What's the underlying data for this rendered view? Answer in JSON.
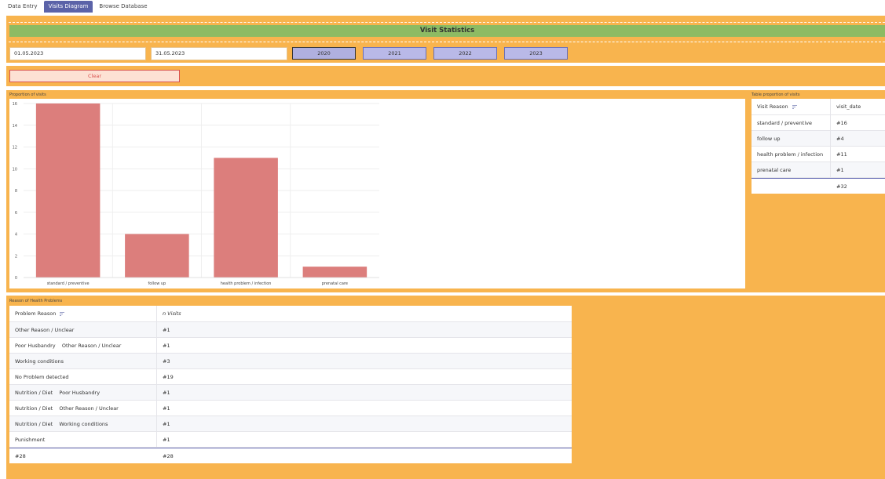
{
  "tabs": [
    {
      "label": "Data Entry"
    },
    {
      "label": "Visits Diagram"
    },
    {
      "label": "Browse Database"
    }
  ],
  "header": {
    "title": "Visit Statistics"
  },
  "filters": {
    "date_from": "01.05.2023",
    "date_to": "31.05.2023",
    "years": [
      "2020",
      "2021",
      "2022",
      "2023"
    ],
    "selected_year": "2020",
    "clear_label": "Clear"
  },
  "visits_chart": {
    "section_label": "Proportion of visits"
  },
  "chart_data": {
    "type": "bar",
    "title": "",
    "categories": [
      "standard / preventive",
      "follow up",
      "health problem / infection",
      "prenatal care"
    ],
    "values": [
      16,
      4,
      11,
      1
    ],
    "ylim": [
      0,
      16
    ],
    "yticks": [
      0,
      2,
      4,
      6,
      8,
      10,
      12,
      14,
      16
    ],
    "grid": true,
    "color": "#dc7e7c"
  },
  "visits_table": {
    "section_label": "Table proportion of visits",
    "columns": [
      "Visit Reason",
      "visit_date"
    ],
    "rows": [
      [
        "standard / preventive",
        "#16"
      ],
      [
        "follow up",
        "#4"
      ],
      [
        "health problem / infection",
        "#11"
      ],
      [
        "prenatal care",
        "#1"
      ]
    ],
    "total": "#32"
  },
  "health_table": {
    "section_label": "Reason of Health Problems",
    "columns": [
      "Problem Reason",
      "n Visits"
    ],
    "rows": [
      [
        "Other Reason / Unclear",
        "#1"
      ],
      [
        "Poor Husbandry    Other Reason / Unclear",
        "#1"
      ],
      [
        "Working conditions",
        "#3"
      ],
      [
        "No Problem detected",
        "#19"
      ],
      [
        "Nutrition / Diet    Poor Husbandry",
        "#1"
      ],
      [
        "Nutrition / Diet    Other Reason / Unclear",
        "#1"
      ],
      [
        "Nutrition / Diet    Working conditions",
        "#1"
      ],
      [
        "Punishment",
        "#1"
      ]
    ],
    "total_left": "#28",
    "total_right": "#28"
  },
  "colors": {
    "panel": "#f8b44e",
    "title_bar": "#8dbb63",
    "active_tab": "#5b63a8",
    "bar": "#dc7e7c",
    "year_button": "#b9b9e8"
  }
}
